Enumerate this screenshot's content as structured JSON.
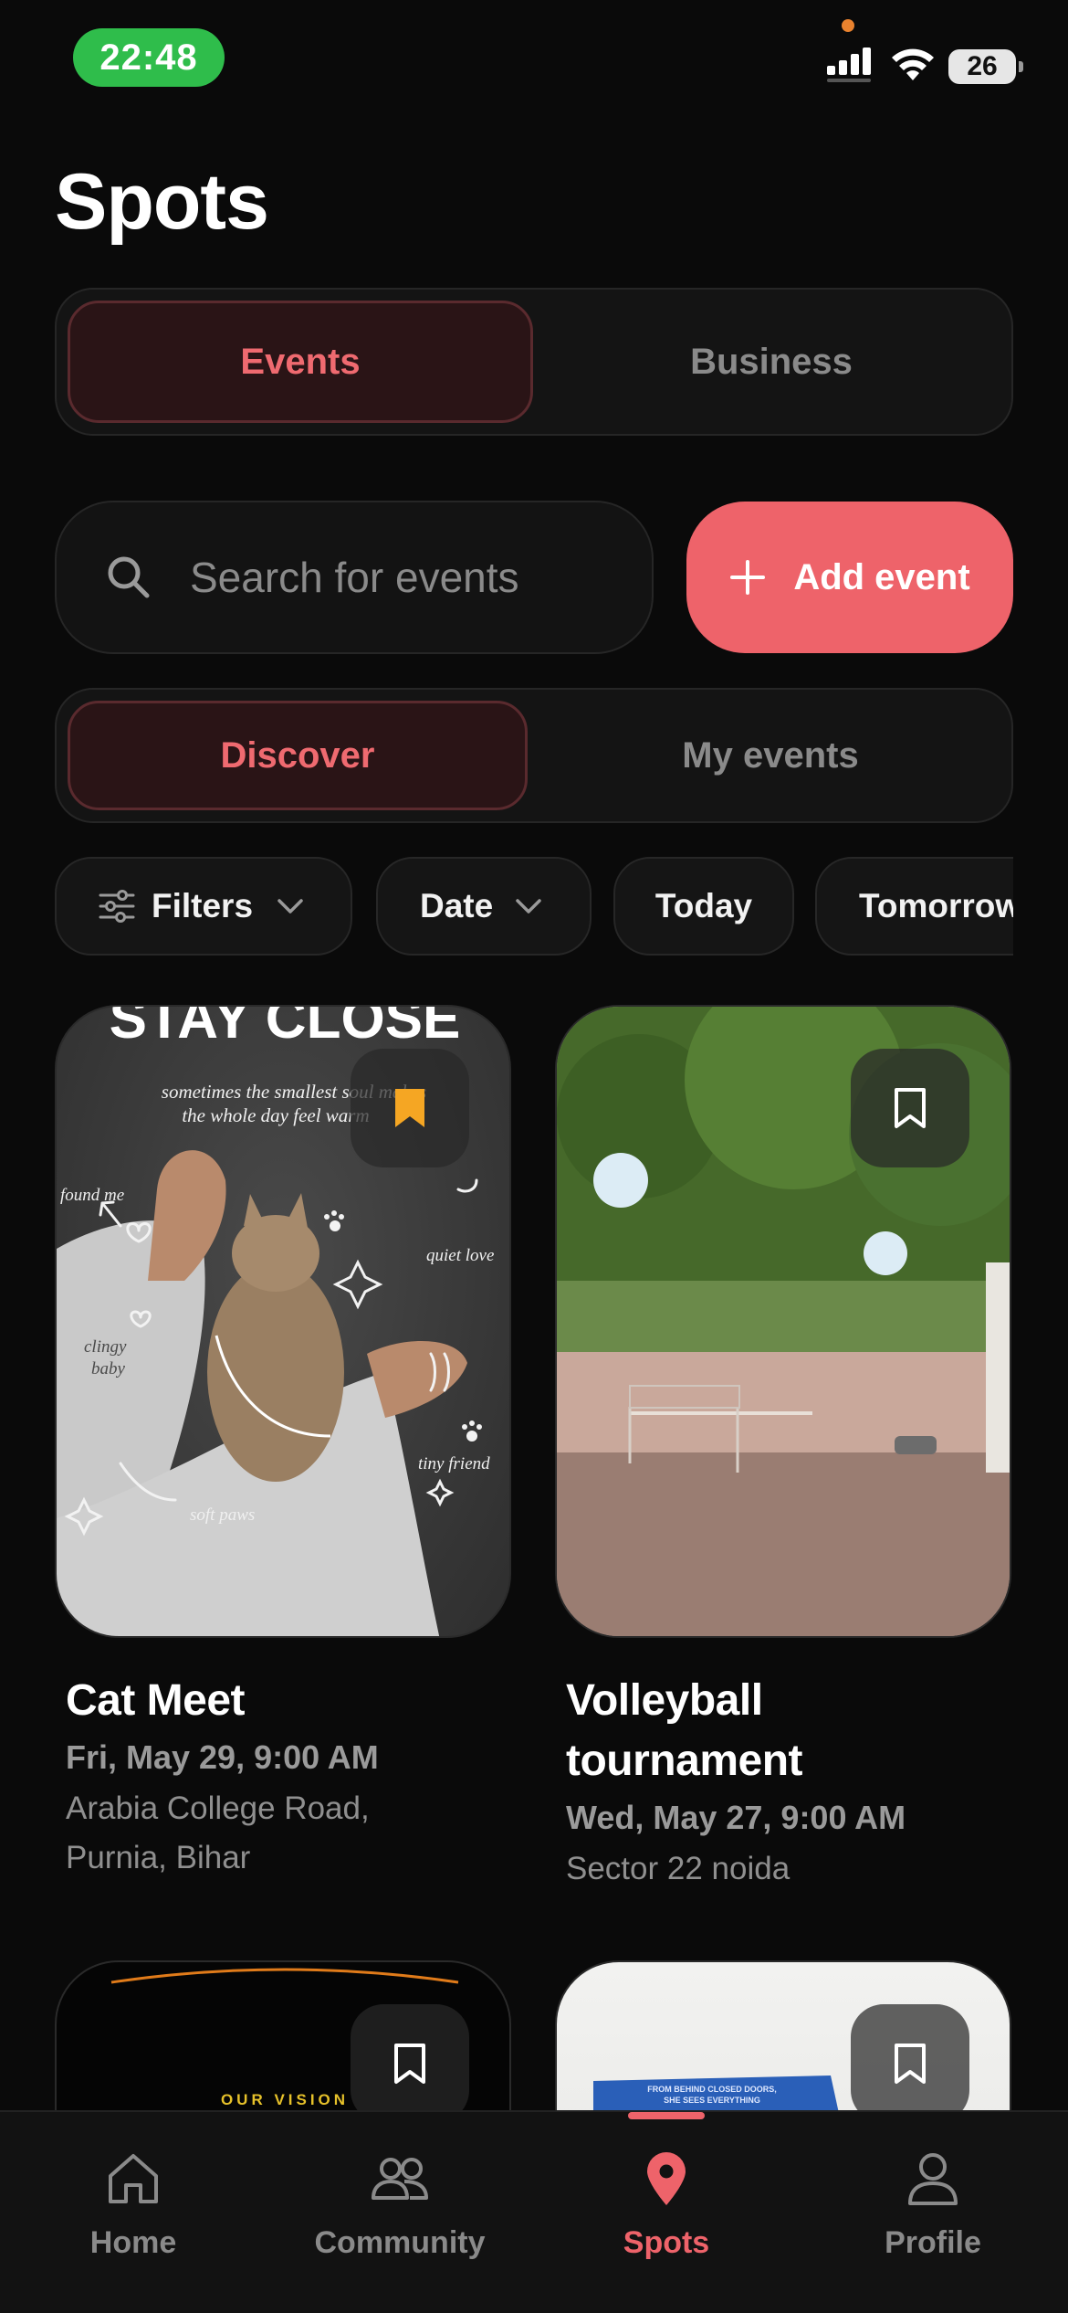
{
  "status_bar": {
    "time": "22:48",
    "battery": "26"
  },
  "page_title": "Spots",
  "mode_tabs": {
    "events": "Events",
    "business": "Business",
    "active": "events"
  },
  "search": {
    "placeholder": "Search for events"
  },
  "add_event": {
    "label": "Add event"
  },
  "view_tabs": {
    "discover": "Discover",
    "my_events": "My events",
    "active": "discover"
  },
  "filters": {
    "filters": "Filters",
    "date": "Date",
    "today": "Today",
    "tomorrow": "Tomorrow"
  },
  "cards": [
    {
      "title": "Cat Meet",
      "date": "Fri, May 29, 9:00 AM",
      "location_line1": "Arabia College Road,",
      "location_line2": "Purnia, Bihar",
      "bookmarked": true,
      "image": {
        "heading": "STAY CLOSE",
        "line1": "sometimes the smallest soul makes",
        "line2": "the whole day feel warm",
        "note_found": "found me",
        "note_quiet": "quiet love",
        "note_clingy": "clingy",
        "note_baby": "baby",
        "note_tiny": "tiny friend",
        "note_paws": "soft paws"
      }
    },
    {
      "title_line1": "Volleyball",
      "title_line2": "tournament",
      "date": "Wed, May 27, 9:00 AM",
      "location_line1": "Sector 22 noida",
      "bookmarked": false
    },
    {
      "image_text": "OUR VISION",
      "bookmarked": false
    },
    {
      "image_text_1": "FROM BEHIND CLOSED DOORS,",
      "image_text_2": "SHE SEES EVERYTHING",
      "bookmarked": false
    }
  ],
  "tabbar": {
    "home": "Home",
    "community": "Community",
    "spots": "Spots",
    "profile": "Profile",
    "active": "spots"
  },
  "colors": {
    "accent": "#ee636a",
    "bookmark_active": "#f5a623",
    "background": "#0a0a0a",
    "status_pill": "#2fbd4b"
  }
}
